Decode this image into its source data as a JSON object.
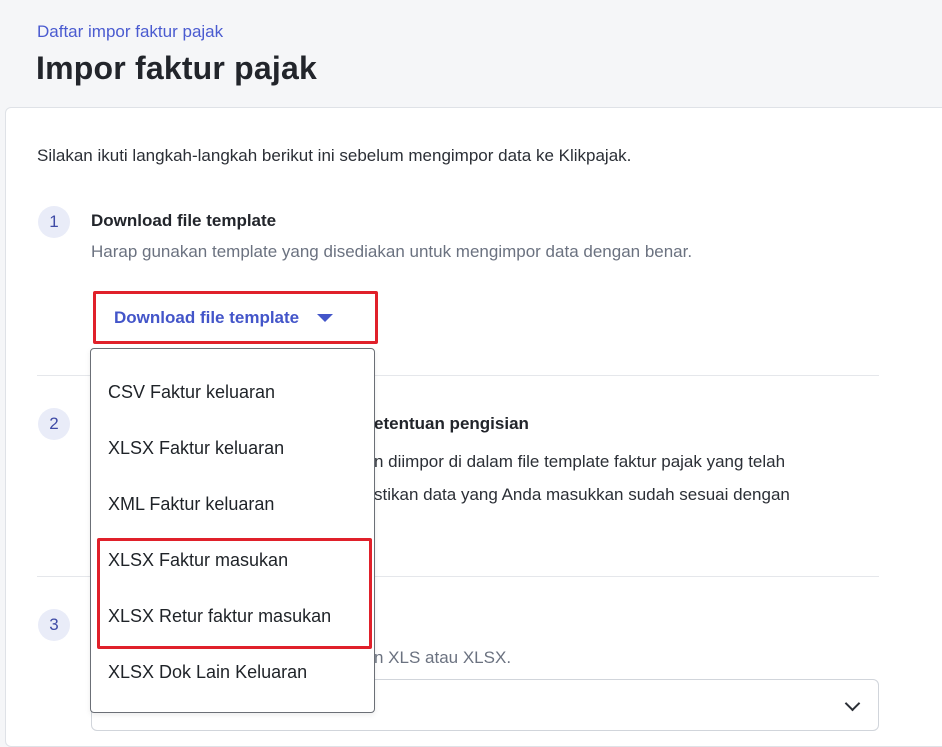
{
  "header": {
    "breadcrumb": "Daftar impor faktur pajak",
    "title": "Impor faktur pajak"
  },
  "intro": "Silakan ikuti langkah-langkah berikut ini sebelum mengimpor data ke Klikpajak.",
  "steps": [
    {
      "number": "1",
      "title": "Download file template",
      "desc": "Harap gunakan template yang disediakan untuk mengimpor data dengan benar."
    },
    {
      "number": "2",
      "title_partial": "etentuan pengisian",
      "desc_line1": "n diimpor di dalam file template faktur pajak yang telah",
      "desc_line2": "stikan data yang Anda masukkan sudah sesuai dengan"
    },
    {
      "number": "3",
      "desc_partial": "n XLS atau XLSX."
    }
  ],
  "download_button": {
    "label": "Download file template"
  },
  "dropdown": {
    "items": [
      "CSV Faktur keluaran",
      "XLSX Faktur keluaran",
      "XML Faktur keluaran",
      "XLSX Faktur masukan",
      "XLSX Retur faktur masukan",
      "XLSX Dok Lain Keluaran"
    ]
  },
  "colors": {
    "accent": "#4355c9",
    "highlight": "#e0202a",
    "breadcrumb": "#4a5bd0"
  }
}
